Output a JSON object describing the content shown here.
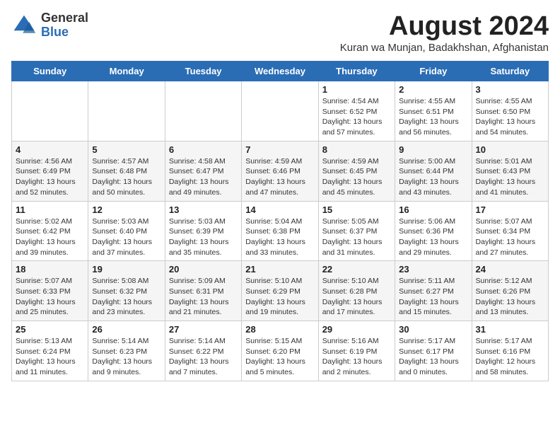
{
  "logo": {
    "general": "General",
    "blue": "Blue"
  },
  "header": {
    "month": "August 2024",
    "location": "Kuran wa Munjan, Badakhshan, Afghanistan"
  },
  "weekdays": [
    "Sunday",
    "Monday",
    "Tuesday",
    "Wednesday",
    "Thursday",
    "Friday",
    "Saturday"
  ],
  "weeks": [
    [
      {
        "day": "",
        "info": ""
      },
      {
        "day": "",
        "info": ""
      },
      {
        "day": "",
        "info": ""
      },
      {
        "day": "",
        "info": ""
      },
      {
        "day": "1",
        "info": "Sunrise: 4:54 AM\nSunset: 6:52 PM\nDaylight: 13 hours\nand 57 minutes."
      },
      {
        "day": "2",
        "info": "Sunrise: 4:55 AM\nSunset: 6:51 PM\nDaylight: 13 hours\nand 56 minutes."
      },
      {
        "day": "3",
        "info": "Sunrise: 4:55 AM\nSunset: 6:50 PM\nDaylight: 13 hours\nand 54 minutes."
      }
    ],
    [
      {
        "day": "4",
        "info": "Sunrise: 4:56 AM\nSunset: 6:49 PM\nDaylight: 13 hours\nand 52 minutes."
      },
      {
        "day": "5",
        "info": "Sunrise: 4:57 AM\nSunset: 6:48 PM\nDaylight: 13 hours\nand 50 minutes."
      },
      {
        "day": "6",
        "info": "Sunrise: 4:58 AM\nSunset: 6:47 PM\nDaylight: 13 hours\nand 49 minutes."
      },
      {
        "day": "7",
        "info": "Sunrise: 4:59 AM\nSunset: 6:46 PM\nDaylight: 13 hours\nand 47 minutes."
      },
      {
        "day": "8",
        "info": "Sunrise: 4:59 AM\nSunset: 6:45 PM\nDaylight: 13 hours\nand 45 minutes."
      },
      {
        "day": "9",
        "info": "Sunrise: 5:00 AM\nSunset: 6:44 PM\nDaylight: 13 hours\nand 43 minutes."
      },
      {
        "day": "10",
        "info": "Sunrise: 5:01 AM\nSunset: 6:43 PM\nDaylight: 13 hours\nand 41 minutes."
      }
    ],
    [
      {
        "day": "11",
        "info": "Sunrise: 5:02 AM\nSunset: 6:42 PM\nDaylight: 13 hours\nand 39 minutes."
      },
      {
        "day": "12",
        "info": "Sunrise: 5:03 AM\nSunset: 6:40 PM\nDaylight: 13 hours\nand 37 minutes."
      },
      {
        "day": "13",
        "info": "Sunrise: 5:03 AM\nSunset: 6:39 PM\nDaylight: 13 hours\nand 35 minutes."
      },
      {
        "day": "14",
        "info": "Sunrise: 5:04 AM\nSunset: 6:38 PM\nDaylight: 13 hours\nand 33 minutes."
      },
      {
        "day": "15",
        "info": "Sunrise: 5:05 AM\nSunset: 6:37 PM\nDaylight: 13 hours\nand 31 minutes."
      },
      {
        "day": "16",
        "info": "Sunrise: 5:06 AM\nSunset: 6:36 PM\nDaylight: 13 hours\nand 29 minutes."
      },
      {
        "day": "17",
        "info": "Sunrise: 5:07 AM\nSunset: 6:34 PM\nDaylight: 13 hours\nand 27 minutes."
      }
    ],
    [
      {
        "day": "18",
        "info": "Sunrise: 5:07 AM\nSunset: 6:33 PM\nDaylight: 13 hours\nand 25 minutes."
      },
      {
        "day": "19",
        "info": "Sunrise: 5:08 AM\nSunset: 6:32 PM\nDaylight: 13 hours\nand 23 minutes."
      },
      {
        "day": "20",
        "info": "Sunrise: 5:09 AM\nSunset: 6:31 PM\nDaylight: 13 hours\nand 21 minutes."
      },
      {
        "day": "21",
        "info": "Sunrise: 5:10 AM\nSunset: 6:29 PM\nDaylight: 13 hours\nand 19 minutes."
      },
      {
        "day": "22",
        "info": "Sunrise: 5:10 AM\nSunset: 6:28 PM\nDaylight: 13 hours\nand 17 minutes."
      },
      {
        "day": "23",
        "info": "Sunrise: 5:11 AM\nSunset: 6:27 PM\nDaylight: 13 hours\nand 15 minutes."
      },
      {
        "day": "24",
        "info": "Sunrise: 5:12 AM\nSunset: 6:26 PM\nDaylight: 13 hours\nand 13 minutes."
      }
    ],
    [
      {
        "day": "25",
        "info": "Sunrise: 5:13 AM\nSunset: 6:24 PM\nDaylight: 13 hours\nand 11 minutes."
      },
      {
        "day": "26",
        "info": "Sunrise: 5:14 AM\nSunset: 6:23 PM\nDaylight: 13 hours\nand 9 minutes."
      },
      {
        "day": "27",
        "info": "Sunrise: 5:14 AM\nSunset: 6:22 PM\nDaylight: 13 hours\nand 7 minutes."
      },
      {
        "day": "28",
        "info": "Sunrise: 5:15 AM\nSunset: 6:20 PM\nDaylight: 13 hours\nand 5 minutes."
      },
      {
        "day": "29",
        "info": "Sunrise: 5:16 AM\nSunset: 6:19 PM\nDaylight: 13 hours\nand 2 minutes."
      },
      {
        "day": "30",
        "info": "Sunrise: 5:17 AM\nSunset: 6:17 PM\nDaylight: 13 hours\nand 0 minutes."
      },
      {
        "day": "31",
        "info": "Sunrise: 5:17 AM\nSunset: 6:16 PM\nDaylight: 12 hours\nand 58 minutes."
      }
    ]
  ]
}
